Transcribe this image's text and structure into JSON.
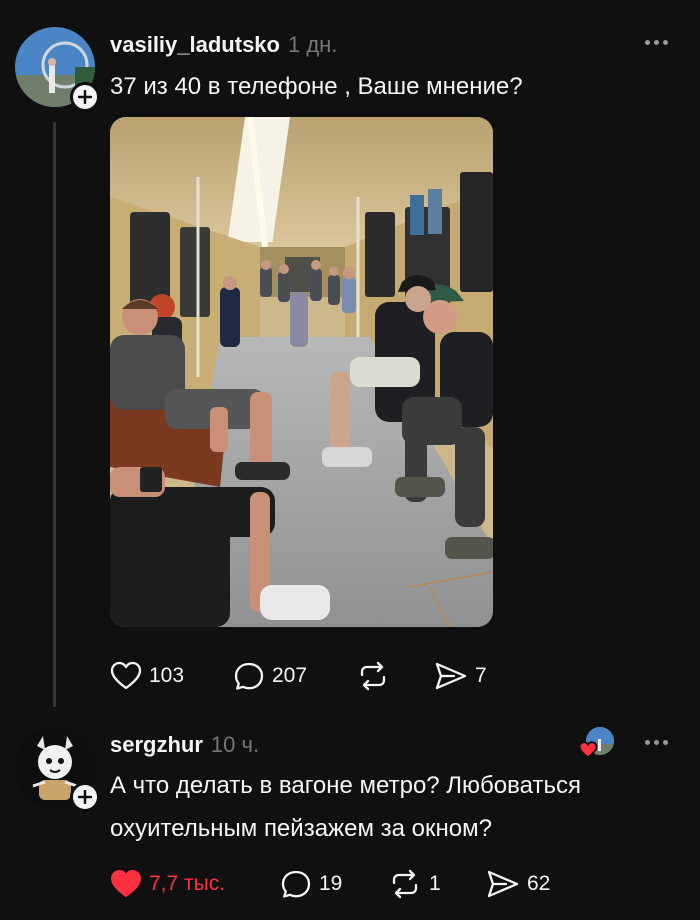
{
  "post": {
    "username": "vasiliy_ladutsko",
    "time": "1 дн.",
    "text": "37 из 40 в телефоне , Ваше мнение?",
    "actions": {
      "likes": "103",
      "replies": "207",
      "reposts": "",
      "shares": "7"
    }
  },
  "reply": {
    "username": "sergzhur",
    "time": "10 ч.",
    "text_line1": "А что делать в вагоне метро? Любоваться",
    "text_line2": "охуительным пейзажем за окном?",
    "actions": {
      "likes": "7,7 тыс.",
      "replies": "19",
      "reposts": "1",
      "shares": "62"
    }
  },
  "colors": {
    "background": "#101010",
    "text": "#f3f5f7",
    "muted": "#777777",
    "like_active": "#ff3040"
  },
  "icons": [
    "heart-icon",
    "comment-icon",
    "repost-icon",
    "share-icon",
    "plus-icon",
    "more-icon"
  ]
}
